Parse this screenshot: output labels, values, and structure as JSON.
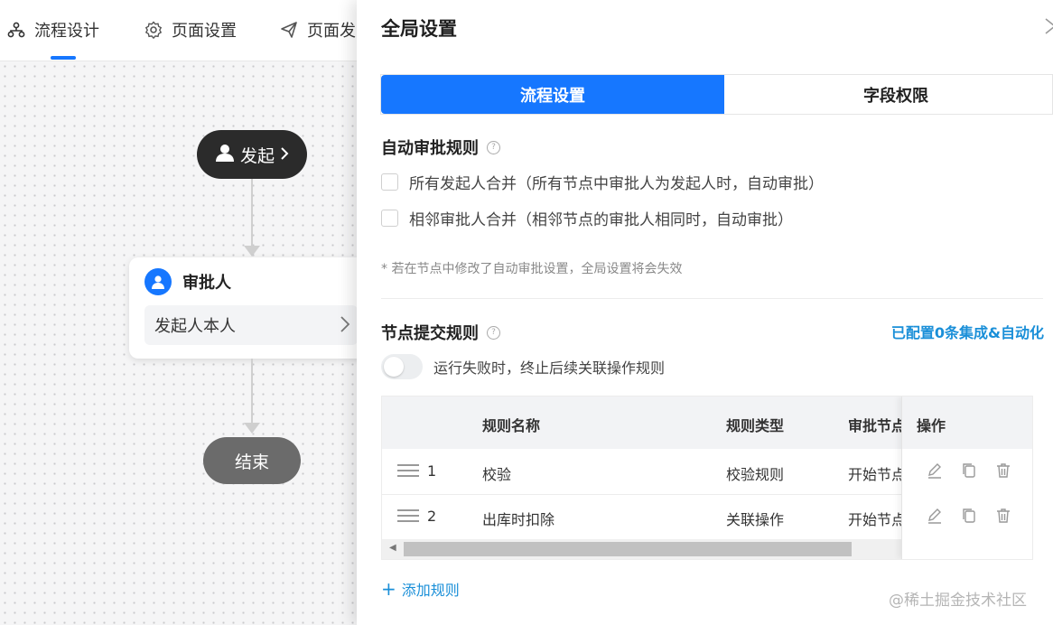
{
  "topnav": {
    "tabs": [
      {
        "label": "流程设计",
        "icon": "flow-icon",
        "active": true
      },
      {
        "label": "页面设置",
        "icon": "gear-icon",
        "active": false
      },
      {
        "label": "页面发",
        "icon": "send-icon",
        "active": false
      }
    ]
  },
  "flow": {
    "start_label": "发起",
    "approver_title": "审批人",
    "approver_value": "发起人本人",
    "end_label": "结束"
  },
  "drawer": {
    "title": "全局设置",
    "segments": [
      "流程设置",
      "字段权限"
    ],
    "auto_approval": {
      "title": "自动审批规则",
      "options": [
        "所有发起人合并（所有节点中审批人为发起人时，自动审批）",
        "相邻审批人合并（相邻节点的审批人相同时，自动审批）"
      ],
      "note": "* 若在节点中修改了自动审批设置，全局设置将会失效"
    },
    "submit_rules": {
      "title": "节点提交规则",
      "link": "已配置0条集成&自动化",
      "toggle_label": "运行失败时，终止后续关联操作规则",
      "columns": [
        "规则名称",
        "规则类型",
        "审批节点",
        "操作"
      ],
      "rows": [
        {
          "index": "1",
          "name": "校验",
          "type": "校验规则",
          "node": "开始节点"
        },
        {
          "index": "2",
          "name": "出库时扣除",
          "type": "关联操作",
          "node": "开始节点"
        }
      ],
      "add_label": "添加规则"
    }
  },
  "watermark": "@稀土掘金技术社区",
  "colors": {
    "accent": "#1677ff",
    "link": "#1a8fd8"
  }
}
